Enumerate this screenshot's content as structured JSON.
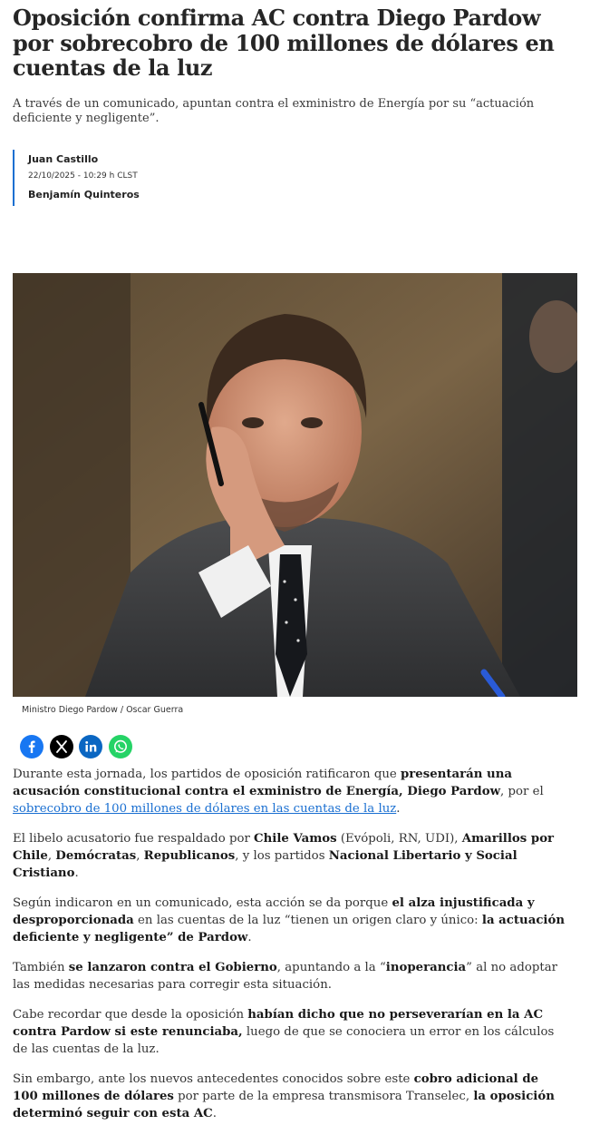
{
  "article": {
    "headline": "Oposición confirma AC contra Diego Pardow por sobrecobro de 100 millones de dólares en cuentas de la luz",
    "dek": "A través de un comunicado, apuntan contra el exministro de Energía por su “actuación deficiente y negligente”.",
    "authors": [
      "Juan Castillo",
      "Benjamín Quinteros"
    ],
    "date": "22/10/2025 - 10:29 h CLST",
    "image_caption": "Ministro Diego Pardow / Oscar Guerra"
  },
  "share": {
    "icons": [
      "facebook-icon",
      "x-icon",
      "linkedin-icon",
      "whatsapp-icon"
    ],
    "colors": {
      "facebook": "#1877f2",
      "x": "#000000",
      "linkedin": "#0a66c2",
      "whatsapp": "#25d366"
    }
  },
  "body": {
    "p1": {
      "t1": "Durante esta jornada, los partidos de oposición ratificaron que ",
      "b1": "presentarán una acusación constitucional contra el exministro de Energía, Diego Pardow",
      "t2": ", por el ",
      "link": "sobrecobro de 100 millones de dólares en las cuentas de la luz",
      "t3": "."
    },
    "p2": {
      "t1": "El libelo acusatorio fue respaldado por ",
      "b1": "Chile Vamos",
      "t2": " (Evópoli, RN, UDI), ",
      "b2": "Amarillos por Chile",
      "t3": ", ",
      "b3": "Demócratas",
      "t4": ", ",
      "b4": "Republicanos",
      "t5": ", y los partidos ",
      "b5": "Nacional Libertario y Social Cristiano",
      "t6": "."
    },
    "p3": {
      "t1": "Según indicaron en un comunicado, esta acción se da porque ",
      "b1": "el alza injustificada y desproporcionada",
      "t2": " en las cuentas de la luz “tienen un origen claro y único: ",
      "b2": "la actuación deficiente y negligente” de Pardow",
      "t3": "."
    },
    "p4": {
      "t1": "También ",
      "b1": "se lanzaron contra el Gobierno",
      "t2": ", apuntando a la “",
      "b2": "inoperancia",
      "t3": "” al no adoptar las medidas necesarias para corregir esta situación."
    },
    "p5": {
      "t1": "Cabe recordar que desde la oposición ",
      "b1": "habían dicho que no perseverarían en la AC contra Pardow si este renunciaba,",
      "t2": " luego de que se conociera un error en los cálculos de las cuentas de la luz."
    },
    "p6": {
      "t1": "Sin embargo, ante los nuevos antecedentes conocidos sobre este ",
      "b1": "cobro adicional de 100 millones de dólares",
      "t2": " por parte de la empresa transmisora Transelec, ",
      "b2": "la oposición determinó seguir con esta AC",
      "t3": "."
    }
  }
}
